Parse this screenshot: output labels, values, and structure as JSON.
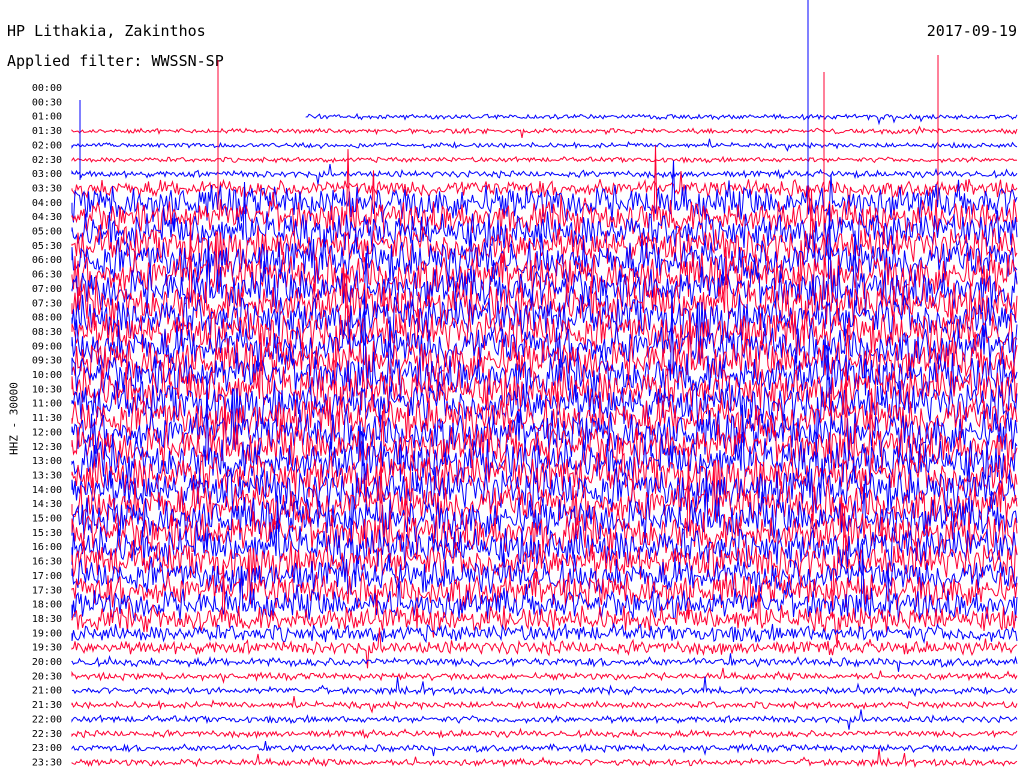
{
  "header": {
    "station": "HP Lithakia, Zakinthos",
    "date": "2017-09-19",
    "filter": "Applied filter: WWSSN-SP"
  },
  "chart_data": {
    "type": "line",
    "title": "HP Lithakia, Zakinthos",
    "subtitle": "Applied filter: WWSSN-SP",
    "date": "2017-09-19",
    "ylabel": "HHZ - 30000",
    "row_labels": [
      "00:00",
      "00:30",
      "01:00",
      "01:30",
      "02:00",
      "02:30",
      "03:00",
      "03:30",
      "04:00",
      "04:30",
      "05:00",
      "05:30",
      "06:00",
      "06:30",
      "07:00",
      "07:30",
      "08:00",
      "08:30",
      "09:00",
      "09:30",
      "10:00",
      "10:30",
      "11:00",
      "11:30",
      "12:00",
      "12:30",
      "13:00",
      "13:30",
      "14:00",
      "14:30",
      "15:00",
      "15:30",
      "16:00",
      "16:30",
      "17:00",
      "17:30",
      "18:00",
      "18:30",
      "19:00",
      "19:30",
      "20:00",
      "20:30",
      "21:00",
      "21:30",
      "22:00",
      "22:30",
      "23:00",
      "23:30"
    ],
    "series_colors": [
      "#0000ff",
      "#ff0033"
    ],
    "amplitude_by_row": [
      0,
      0,
      3,
      3,
      3,
      3,
      4,
      10,
      20,
      20,
      22,
      22,
      25,
      25,
      25,
      25,
      25,
      25,
      25,
      25,
      25,
      25,
      25,
      25,
      25,
      25,
      25,
      25,
      25,
      25,
      24,
      24,
      23,
      22,
      20,
      20,
      18,
      15,
      10,
      8,
      5,
      4,
      4,
      4,
      4,
      4,
      4,
      4
    ],
    "grid": false,
    "legend": "none"
  }
}
